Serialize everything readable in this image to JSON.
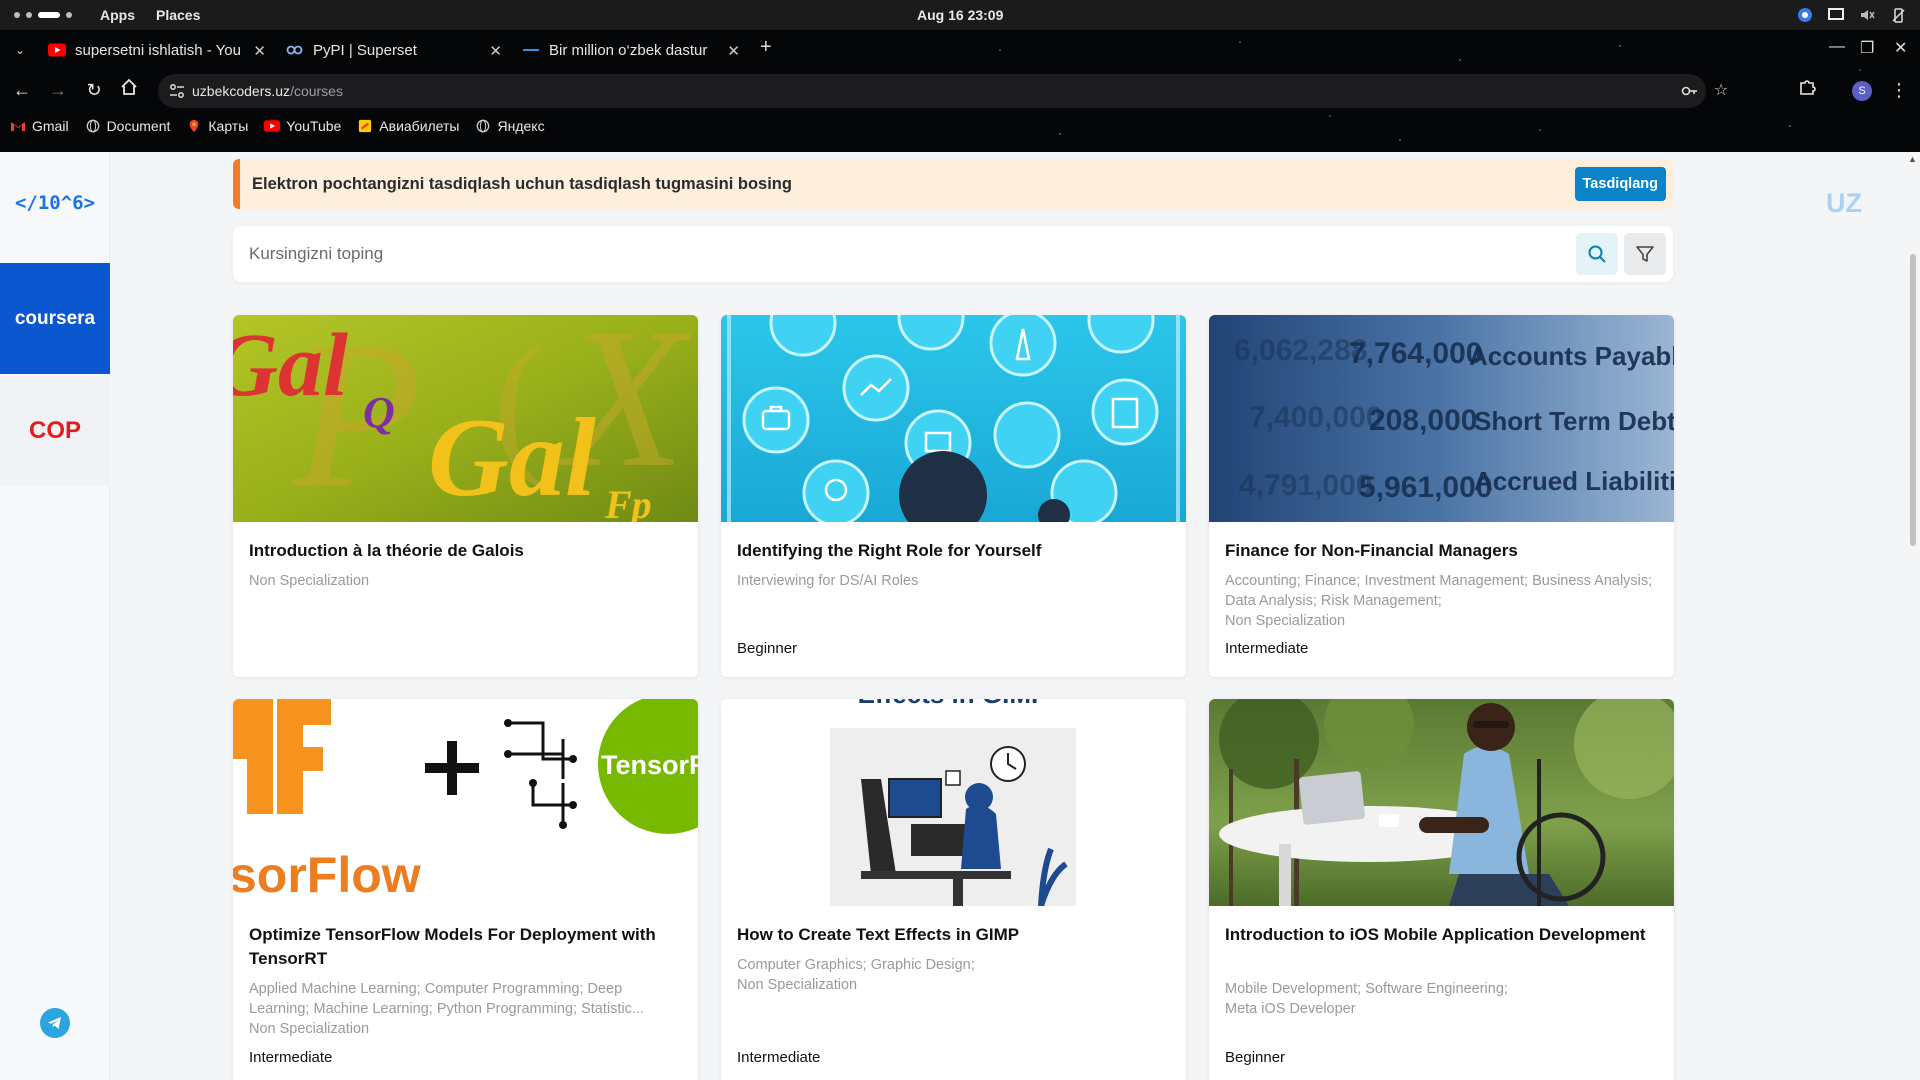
{
  "os": {
    "apps": "Apps",
    "places": "Places",
    "clock": "Aug 16  23:09"
  },
  "browser": {
    "tabs": [
      {
        "title": "supersetni ishlatish - You",
        "favicon": "youtube-icon"
      },
      {
        "title": "PyPI | Superset",
        "favicon": "pypi-icon"
      },
      {
        "title": "Bir million o‘zbek dastur",
        "favicon": "site-icon"
      }
    ],
    "address": {
      "domain": "uzbekcoders.uz",
      "path": "/courses"
    },
    "avatar_letter": "S",
    "bookmarks": [
      {
        "label": "Gmail",
        "icon": "gmail-icon"
      },
      {
        "label": "Document",
        "icon": "globe-icon"
      },
      {
        "label": "Карты",
        "icon": "maps-icon"
      },
      {
        "label": "YouTube",
        "icon": "youtube-icon"
      },
      {
        "label": "Авиабилеты",
        "icon": "tickets-icon"
      },
      {
        "label": "Яндекс",
        "icon": "globe-icon"
      }
    ]
  },
  "sidebar": {
    "logo": "</10^6>",
    "items": [
      {
        "label": "coursera"
      },
      {
        "label": "COP"
      }
    ]
  },
  "lang": "UZ",
  "alert": {
    "text": "Elektron pochtangizni tasdiqlash uchun tasdiqlash tugmasini bosing",
    "button": "Tasdiqlang"
  },
  "search": {
    "placeholder": "Kursingizni toping"
  },
  "courses": [
    {
      "title": "Introduction à la théorie de Galois",
      "tags": "Non Specialization",
      "level": ""
    },
    {
      "title": "Identifying the Right Role for Yourself",
      "tags": "Interviewing for DS/AI Roles",
      "level": "Beginner"
    },
    {
      "title": "Finance for Non-Financial Managers",
      "tags": "Accounting; Finance; Investment Management; Business Analysis; Data Analysis; Risk Management;",
      "tags2": "Non Specialization",
      "level": "Intermediate"
    },
    {
      "title": "Optimize TensorFlow Models For Deployment with TensorRT",
      "tags": "Applied Machine Learning; Computer Programming; Deep Learning; Machine Learning; Python Programming; Statistic...",
      "tags2": "Non Specialization",
      "level": "Intermediate"
    },
    {
      "title": "How to Create Text Effects in GIMP",
      "tags": "Computer Graphics; Graphic Design;",
      "tags2": "Non Specialization",
      "level": "Intermediate"
    },
    {
      "title": "Introduction to iOS Mobile Application Development",
      "tags": "Mobile Development; Software Engineering;",
      "tags2": "Meta iOS Developer",
      "level": "Beginner"
    }
  ],
  "thumb_text": {
    "galois_big": "Gal",
    "galois_left": "Gal",
    "galois_q": "Q",
    "galois_fp": "Fp",
    "finance_rows": [
      {
        "a": "6,062,288",
        "b": "7,764,000",
        "c": "Accounts Payable"
      },
      {
        "a": "7,400,000",
        "b": "208,000",
        "c": "Short Term Debt"
      },
      {
        "a": "4,791,000",
        "b": "5,961,000",
        "c": "Accrued Liabilities"
      }
    ],
    "tf_word": "sorFlow",
    "tensorrt": "TensorR",
    "gimp_header": "Effects in GIMP"
  }
}
